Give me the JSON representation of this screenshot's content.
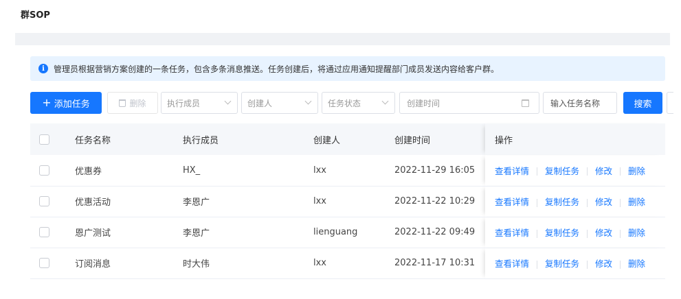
{
  "page": {
    "title": "群SOP"
  },
  "alert": {
    "icon": "info-icon",
    "glyph": "i",
    "text": "管理员根据营销方案创建的一条任务，包含多条消息推送。任务创建后，将通过应用通知提醒部门成员发送内容给客户群。"
  },
  "toolbar": {
    "add_icon": "+",
    "add_label": "添加任务",
    "delete_label": "删除",
    "member_placeholder": "执行成员",
    "creator_placeholder": "创建人",
    "status_placeholder": "任务状态",
    "date_placeholder": "创建时间",
    "name_placeholder": "输入任务名称",
    "search_label": "搜索"
  },
  "table": {
    "headers": {
      "name": "任务名称",
      "member": "执行成员",
      "creator": "创建人",
      "time": "创建时间",
      "ops": "操作"
    },
    "rows": [
      {
        "name": "优惠券",
        "member": "HX_",
        "creator": "lxx",
        "time": "2022-11-29 16:05"
      },
      {
        "name": "优惠活动",
        "member": "李恩广",
        "creator": "lxx",
        "time": "2022-11-22 10:29"
      },
      {
        "name": "恩广测试",
        "member": "李恩广",
        "creator": "lienguang",
        "time": "2022-11-22 09:49"
      },
      {
        "name": "订阅消息",
        "member": "时大伟",
        "creator": "lxx",
        "time": "2022-11-17 10:31"
      }
    ],
    "actions": {
      "view": "查看详情",
      "copy": "复制任务",
      "edit": "修改",
      "delete": "删除"
    }
  },
  "colors": {
    "primary": "#1677ff",
    "alert_bg": "#e8f3ff",
    "header_bg": "#f5f7fa"
  }
}
